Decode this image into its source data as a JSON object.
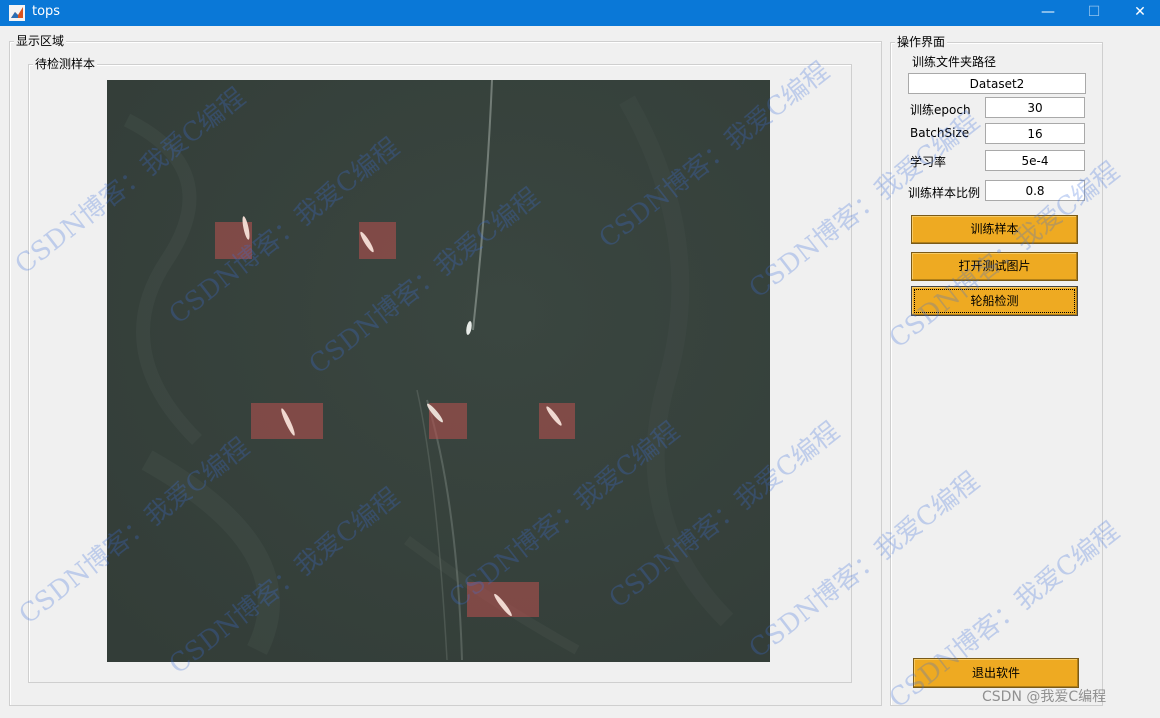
{
  "window": {
    "title": "tops",
    "minimize_glyph": "—",
    "maximize_glyph": "☐",
    "close_glyph": "✕",
    "icon": "matlab-figure-icon"
  },
  "display_panel": {
    "title": "显示区域",
    "sample_group": {
      "title": "待检测样本"
    },
    "image": {
      "description_icon": "aerial-sea-image",
      "detections": 7,
      "box_color": "#b0504e"
    }
  },
  "control_panel": {
    "title": "操作界面",
    "folder_label": "训练文件夹路径",
    "folder_value": "Dataset2",
    "fields": [
      {
        "label": "训练epoch",
        "value": "30"
      },
      {
        "label": "BatchSize",
        "value": "16"
      },
      {
        "label": "学习率",
        "value": "5e-4"
      },
      {
        "label": "训练样本比例",
        "value": "0.8"
      }
    ],
    "buttons": {
      "train": "训练样本",
      "open_image": "打开测试图片",
      "detect": "轮船检测",
      "exit": "退出软件"
    },
    "button_color": "#eeaa22"
  },
  "watermark": {
    "text": "CSDN博客：我爱C编程",
    "credit": "CSDN @我爱C编程"
  },
  "colors": {
    "titlebar": "#0a78d7",
    "background": "#f0f0f0"
  }
}
